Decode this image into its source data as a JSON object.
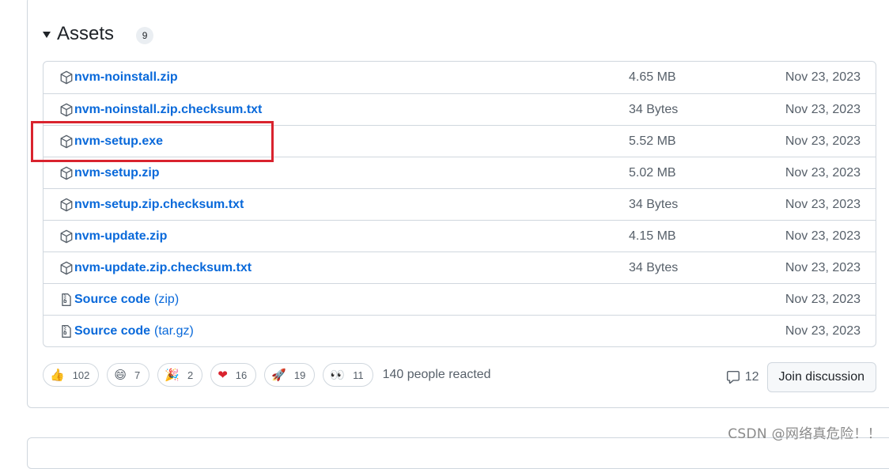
{
  "assets": {
    "title": "Assets",
    "count": "9",
    "items": [
      {
        "name": "nvm-noinstall.zip",
        "suffix": "",
        "size": "4.65 MB",
        "date": "Nov 23, 2023",
        "icon": "package-icon"
      },
      {
        "name": "nvm-noinstall.zip.checksum.txt",
        "suffix": "",
        "size": "34 Bytes",
        "date": "Nov 23, 2023",
        "icon": "package-icon"
      },
      {
        "name": "nvm-setup.exe",
        "suffix": "",
        "size": "5.52 MB",
        "date": "Nov 23, 2023",
        "icon": "package-icon"
      },
      {
        "name": "nvm-setup.zip",
        "suffix": "",
        "size": "5.02 MB",
        "date": "Nov 23, 2023",
        "icon": "package-icon"
      },
      {
        "name": "nvm-setup.zip.checksum.txt",
        "suffix": "",
        "size": "34 Bytes",
        "date": "Nov 23, 2023",
        "icon": "package-icon"
      },
      {
        "name": "nvm-update.zip",
        "suffix": "",
        "size": "4.15 MB",
        "date": "Nov 23, 2023",
        "icon": "package-icon"
      },
      {
        "name": "nvm-update.zip.checksum.txt",
        "suffix": "",
        "size": "34 Bytes",
        "date": "Nov 23, 2023",
        "icon": "package-icon"
      },
      {
        "name": "Source code",
        "suffix": "(zip)",
        "size": "",
        "date": "Nov 23, 2023",
        "icon": "file-zip-icon"
      },
      {
        "name": "Source code",
        "suffix": "(tar.gz)",
        "size": "",
        "date": "Nov 23, 2023",
        "icon": "file-zip-icon"
      }
    ]
  },
  "reactions": {
    "items": [
      {
        "emoji": "👍",
        "count": "102",
        "icon": "thumbs-up-icon"
      },
      {
        "emoji": "😄",
        "count": "7",
        "icon": "smile-icon"
      },
      {
        "emoji": "🎉",
        "count": "2",
        "icon": "tada-icon"
      },
      {
        "emoji": "❤",
        "count": "16",
        "icon": "heart-icon"
      },
      {
        "emoji": "🚀",
        "count": "19",
        "icon": "rocket-icon"
      },
      {
        "emoji": "👀",
        "count": "11",
        "icon": "eyes-icon"
      }
    ],
    "summary": "140 people reacted"
  },
  "discussion": {
    "comment_count": "12",
    "join_label": "Join discussion"
  },
  "watermark": "CSDN @网络真危险！！",
  "colors": {
    "link": "#0969da",
    "highlight": "#d9232e",
    "border": "#d0d7de"
  }
}
